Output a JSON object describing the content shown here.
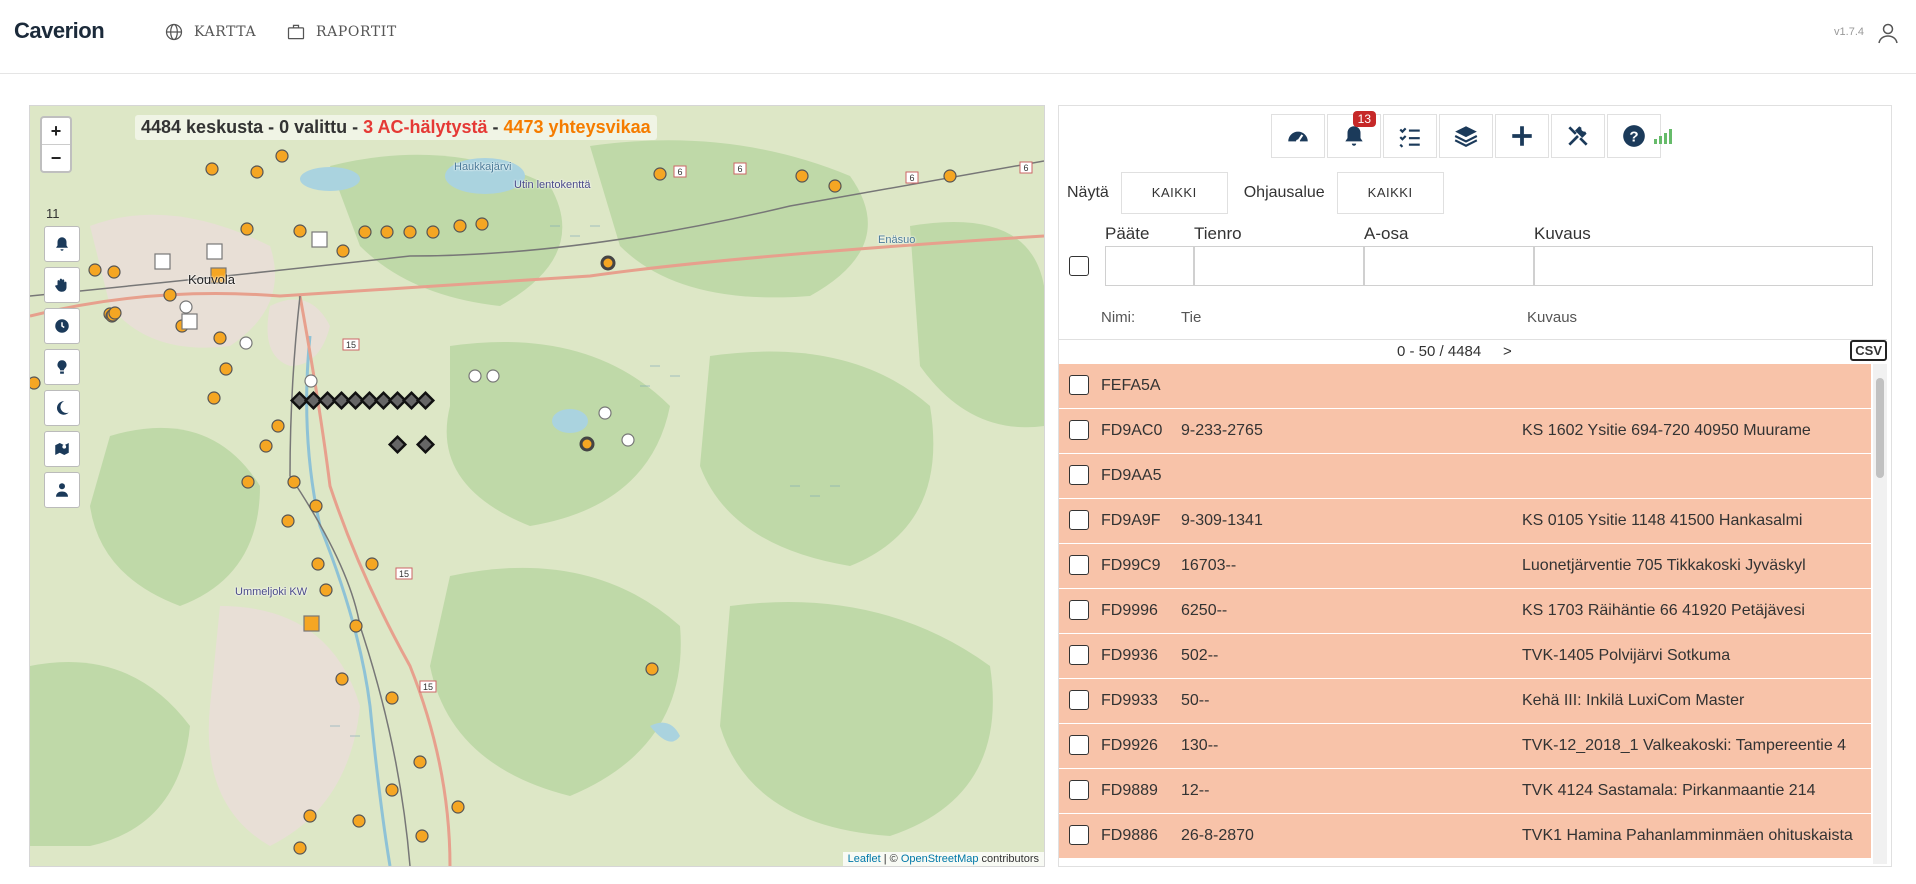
{
  "header": {
    "brand": "Caverion",
    "nav": [
      {
        "label": "KARTTA",
        "icon": "globe-icon"
      },
      {
        "label": "RAPORTIT",
        "icon": "briefcase-icon"
      }
    ],
    "version": "v1.7.4",
    "user_icon": "user-icon"
  },
  "map": {
    "status": {
      "count": "4484 keskusta",
      "selected": "0 valittu",
      "alarms": "3 AC-hälytystä",
      "connection": "4473 yhteysvikaa",
      "sep": " - "
    },
    "zoom_in": "+",
    "zoom_out": "−",
    "zoom_level": "11",
    "tools": [
      "bell-icon",
      "hand-icon",
      "clock-icon",
      "bulb-icon",
      "moon-icon",
      "map-icon",
      "person-icon"
    ],
    "places": [
      "Kouvola",
      "Haukkajärvi",
      "Utin lentokenttä",
      "Ummeljoki KW",
      "Enäsuo"
    ],
    "road_labels": [
      "6",
      "6",
      "6",
      "6",
      "15",
      "15",
      "15"
    ],
    "attribution": {
      "leaflet": "Leaflet",
      "sep": " | © ",
      "osm": "OpenStreetMap",
      "rest": " contributors"
    }
  },
  "panel": {
    "toolbar": [
      {
        "icon": "dashboard-icon"
      },
      {
        "icon": "bell-icon",
        "badge": "13"
      },
      {
        "icon": "checklist-icon"
      },
      {
        "icon": "layers-icon"
      },
      {
        "icon": "plus-icon"
      },
      {
        "icon": "tools-icon"
      },
      {
        "icon": "help-icon"
      }
    ],
    "signal_icon": "signal-icon",
    "filters": {
      "show_label": "Näytä",
      "show_value": "KAIKKI",
      "area_label": "Ohjausalue",
      "area_value": "KAIKKI"
    },
    "columns": {
      "paate": "Pääte",
      "tienro": "Tienro",
      "aosa": "A-osa",
      "kuvaus": "Kuvaus"
    },
    "list_header": {
      "nimi": "Nimi:",
      "tie": "Tie",
      "kuvaus": "Kuvaus"
    },
    "pager": {
      "range": "0 - 50 / 4484",
      "next": ">",
      "csv": "CSV"
    },
    "rows": [
      {
        "name": "FEFA5A",
        "road": "",
        "desc": ""
      },
      {
        "name": "FD9AC0",
        "road": "9-233-2765",
        "desc": "KS 1602 Ysitie 694-720 40950 Muurame"
      },
      {
        "name": "FD9AA5",
        "road": "",
        "desc": ""
      },
      {
        "name": "FD9A9F",
        "road": "9-309-1341",
        "desc": "KS 0105 Ysitie 1148 41500 Hankasalmi"
      },
      {
        "name": "FD99C9",
        "road": "16703--",
        "desc": "Luonetjärventie 705 Tikkakoski Jyväskyl"
      },
      {
        "name": "FD9996",
        "road": "6250--",
        "desc": "KS 1703 Räihäntie 66 41920 Petäjävesi"
      },
      {
        "name": "FD9936",
        "road": "502--",
        "desc": "TVK-1405 Polvijärvi Sotkuma"
      },
      {
        "name": "FD9933",
        "road": "50--",
        "desc": "Kehä III: Inkilä LuxiCom Master"
      },
      {
        "name": "FD9926",
        "road": "130--",
        "desc": "TVK-12_2018_1 Valkeakoski: Tampereentie 4"
      },
      {
        "name": "FD9889",
        "road": "12--",
        "desc": "TVK 4124 Sastamala: Pirkanmaantie 214"
      },
      {
        "name": "FD9886",
        "road": "26-8-2870",
        "desc": "TVK1 Hamina Pahanlamminmäen ohituskaista"
      }
    ],
    "colors": {
      "row_bg": "#f8c3a9",
      "badge": "#c62828",
      "alarm": "#e53935",
      "fault": "#f57c00"
    }
  }
}
